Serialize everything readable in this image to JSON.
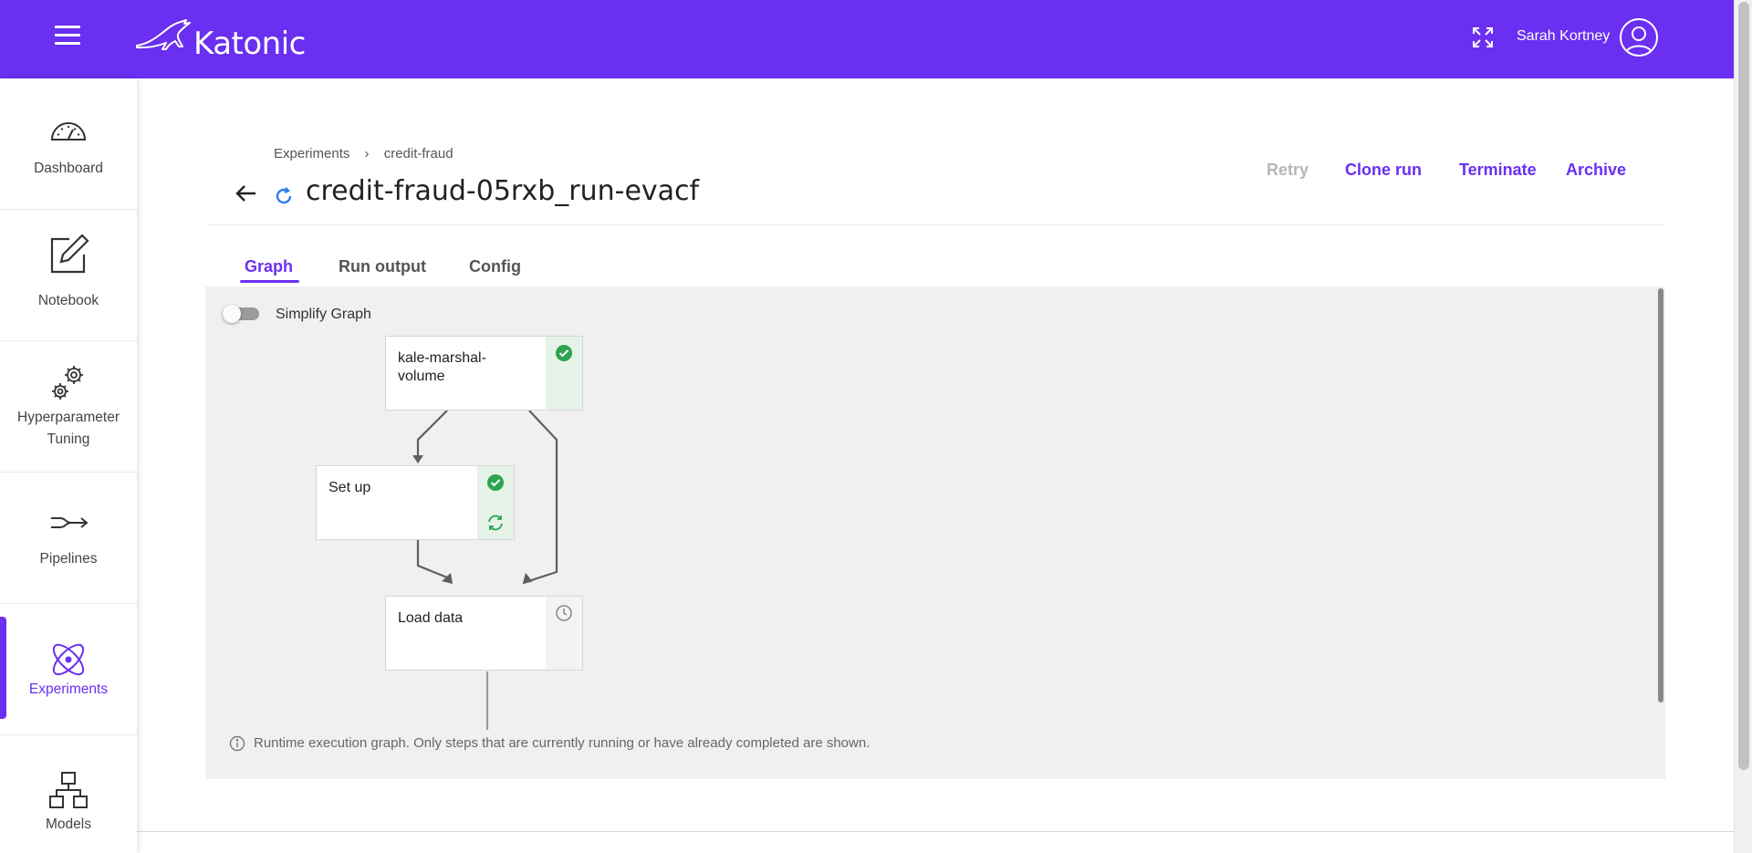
{
  "header": {
    "logo_text": "Katonic",
    "user_name": "Sarah Kortney",
    "brand_color": "#6a2ff0"
  },
  "sidebar": {
    "items": [
      {
        "label": "Dashboard",
        "icon": "gauge-icon"
      },
      {
        "label": "Notebook",
        "icon": "edit-icon"
      },
      {
        "label": "Hyperparameter Tuning",
        "icon": "gears-icon"
      },
      {
        "label": "Pipelines",
        "icon": "pipeline-icon"
      },
      {
        "label": "Experiments",
        "icon": "atom-icon",
        "active": true
      },
      {
        "label": "Models",
        "icon": "hierarchy-icon"
      }
    ]
  },
  "breadcrumb": {
    "root": "Experiments",
    "separator": "›",
    "current": "credit-fraud"
  },
  "run": {
    "title": "credit-fraud-05rxb_run-evacf"
  },
  "actions": {
    "retry": "Retry",
    "clone_run": "Clone run",
    "terminate": "Terminate",
    "archive": "Archive"
  },
  "tabs": {
    "graph": "Graph",
    "run_output": "Run output",
    "config": "Config"
  },
  "graph": {
    "simplify_label": "Simplify Graph",
    "simplify_enabled": false,
    "nodes": {
      "marshal": {
        "label": "kale-marshal-volume",
        "status": "succeeded"
      },
      "setup": {
        "label": "Set up",
        "status": "succeeded"
      },
      "load": {
        "label": "Load data",
        "status": "pending"
      }
    },
    "status_colors": {
      "succeeded": "#2ea44f",
      "pending": "#9e9e9e"
    },
    "footer_note": "Runtime execution graph. Only steps that are currently running or have already completed are shown."
  }
}
